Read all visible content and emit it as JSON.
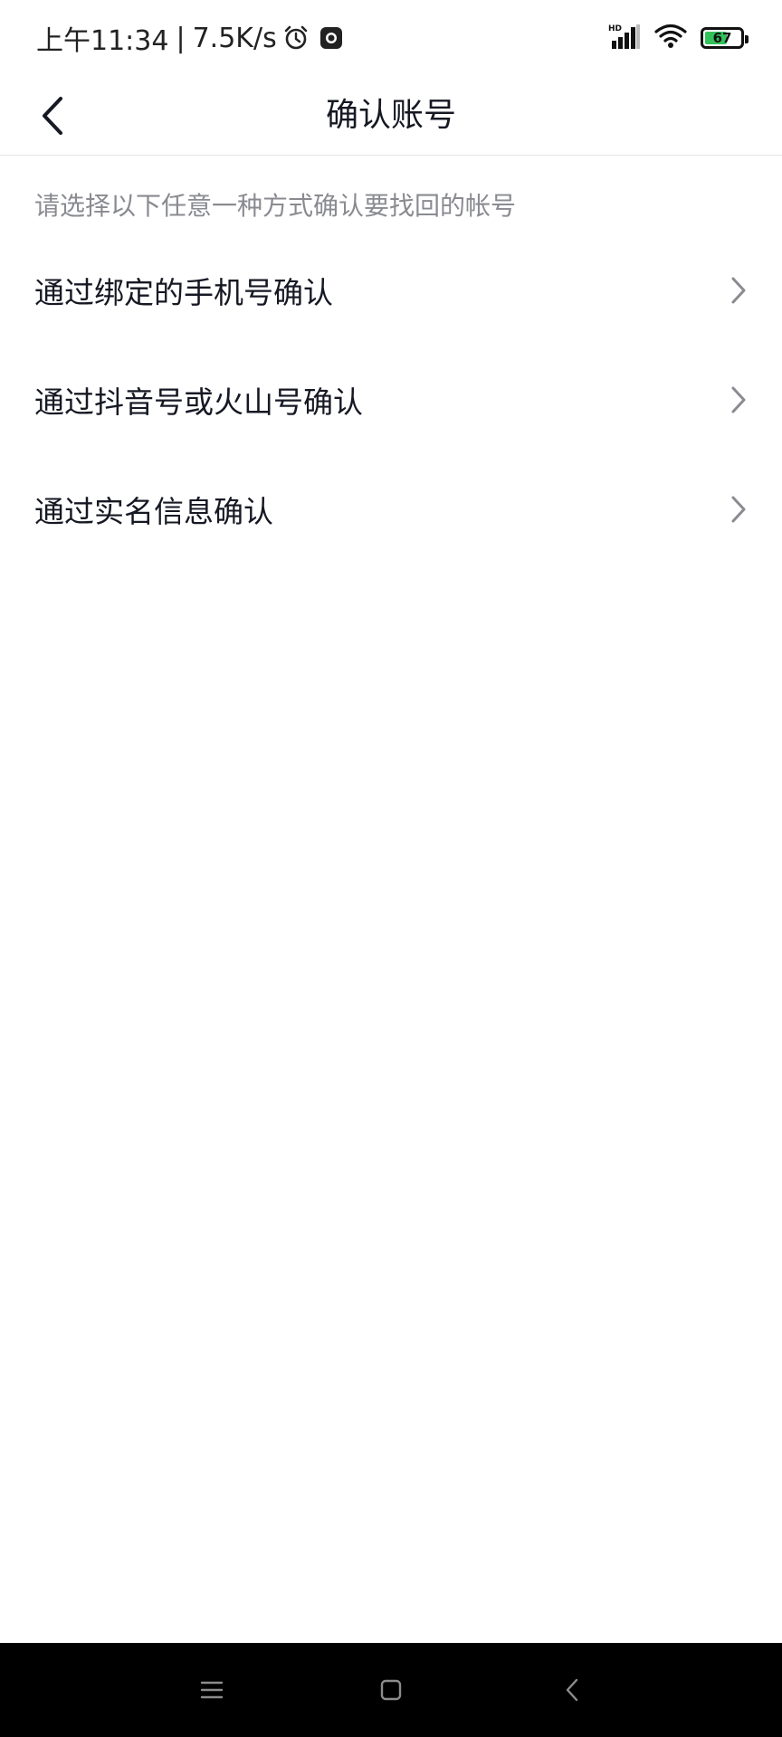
{
  "status_bar": {
    "time": "上午11:34",
    "separator": "|",
    "net_speed": "7.5K/s",
    "signal_badge": "HD",
    "battery_level": "67",
    "icons": [
      "alarm-icon",
      "screen-record-icon",
      "signal-icon",
      "wifi-icon",
      "battery-icon"
    ]
  },
  "nav": {
    "title": "确认账号",
    "back_icon": "chevron-left-icon"
  },
  "content": {
    "hint": "请选择以下任意一种方式确认要找回的帐号",
    "options": [
      {
        "label": "通过绑定的手机号确认",
        "icon": "chevron-right-icon"
      },
      {
        "label": "通过抖音号或火山号确认",
        "icon": "chevron-right-icon"
      },
      {
        "label": "通过实名信息确认",
        "icon": "chevron-right-icon"
      }
    ]
  },
  "system_nav": {
    "buttons": [
      "menu-icon",
      "home-icon",
      "back-icon"
    ]
  },
  "colors": {
    "text_primary": "#161823",
    "text_secondary": "#8a8b91",
    "chevron": "#8a8b91",
    "divider": "#e6e6e8",
    "battery_green": "#32c25a",
    "system_nav_bg": "#000000"
  }
}
